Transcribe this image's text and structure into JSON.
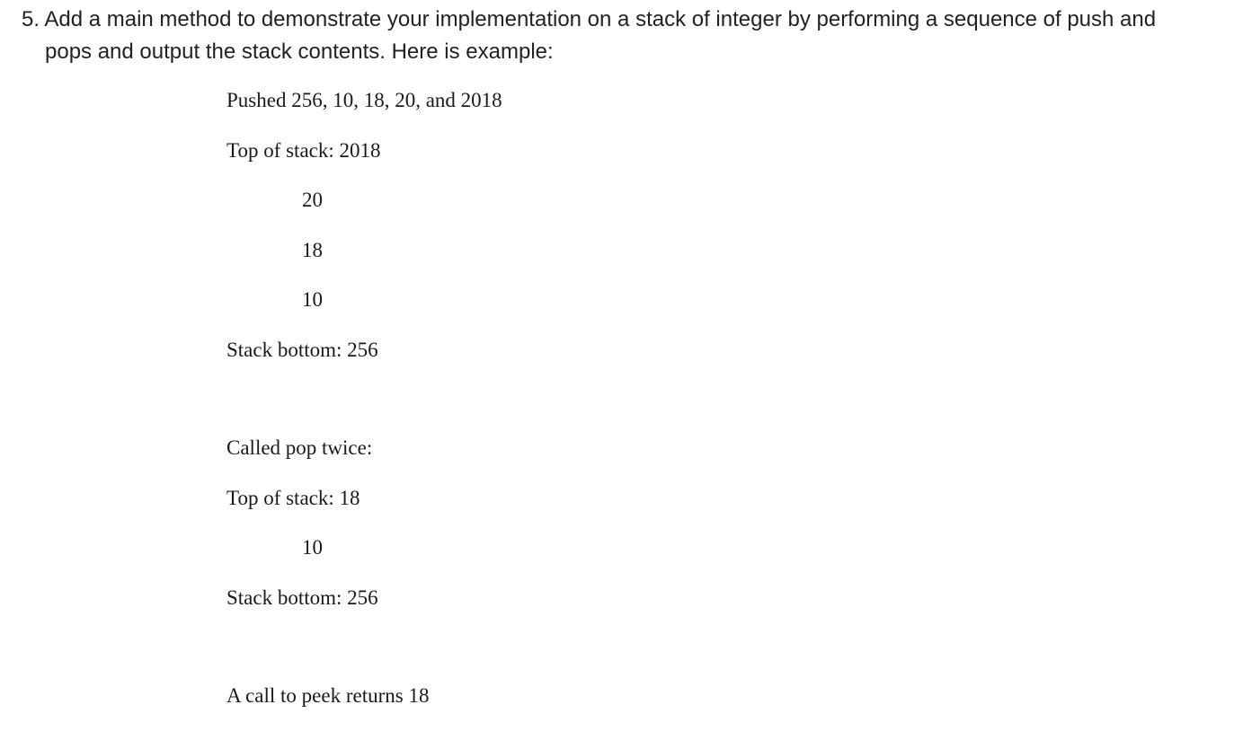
{
  "question": {
    "number": "5.",
    "line1": "Add a main method to demonstrate your implementation on a stack of integer by performing a sequence of push and",
    "line2": "pops and output the stack contents. Here is example:"
  },
  "example": {
    "pushed": "Pushed 256, 10, 18, 20, and 2018",
    "top1": "Top of stack: 2018",
    "item1": "20",
    "item2": "18",
    "item3": "10",
    "bottom1": "Stack bottom: 256",
    "popped": "Called pop twice:",
    "top2": "Top of stack: 18",
    "item4": "10",
    "bottom2": "Stack bottom: 256",
    "peek": "A call to peek returns 18"
  }
}
